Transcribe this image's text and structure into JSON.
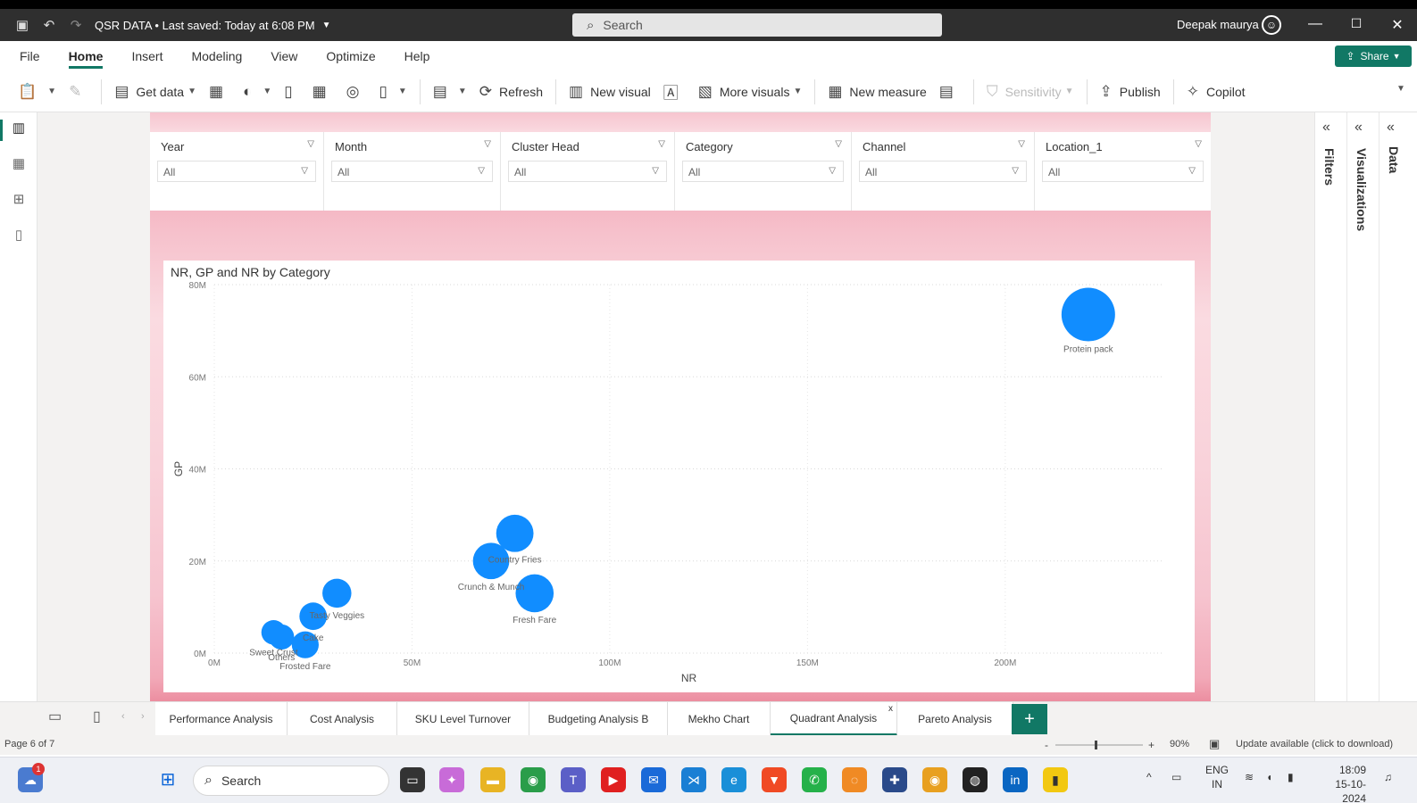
{
  "titlebar": {
    "title": "QSR DATA • Last saved: Today at 6:08 PM",
    "search_placeholder": "Search",
    "user": "Deepak maurya"
  },
  "menu": [
    "File",
    "Home",
    "Insert",
    "Modeling",
    "View",
    "Optimize",
    "Help"
  ],
  "share_label": "Share",
  "ribbon": {
    "get_data": "Get data",
    "refresh": "Refresh",
    "new_visual": "New visual",
    "more_visuals": "More visuals",
    "new_measure": "New measure",
    "sensitivity": "Sensitivity",
    "publish": "Publish",
    "copilot": "Copilot"
  },
  "slicers": [
    {
      "label": "Year",
      "value": "All"
    },
    {
      "label": "Month",
      "value": "All"
    },
    {
      "label": "Cluster Head",
      "value": "All"
    },
    {
      "label": "Category",
      "value": "All"
    },
    {
      "label": "Channel",
      "value": "All"
    },
    {
      "label": "Location_1",
      "value": "All"
    }
  ],
  "right_panes": {
    "filters": "Filters",
    "visualizations": "Visualizations",
    "data": "Data"
  },
  "chart_data": {
    "type": "scatter",
    "title": "NR, GP and NR by Category",
    "xlabel": "NR",
    "ylabel": "GP",
    "x_ticks": [
      "0M",
      "50M",
      "100M",
      "150M",
      "200M"
    ],
    "y_ticks": [
      "0M",
      "20M",
      "40M",
      "60M",
      "80M"
    ],
    "xlim": [
      0,
      240
    ],
    "ylim": [
      0,
      80
    ],
    "x_unit": "M",
    "y_unit": "M",
    "grid": true,
    "color": "#118DFF",
    "points": [
      {
        "label": "Protein pack",
        "x": 221,
        "y": 73.5,
        "size": 221
      },
      {
        "label": "Country Fries",
        "x": 76,
        "y": 26,
        "size": 76
      },
      {
        "label": "Crunch & Munch",
        "x": 70,
        "y": 20,
        "size": 70
      },
      {
        "label": "Fresh Fare",
        "x": 81,
        "y": 13,
        "size": 81
      },
      {
        "label": "Tasty Veggies",
        "x": 31,
        "y": 13,
        "size": 31
      },
      {
        "label": "Cake",
        "x": 25,
        "y": 8,
        "size": 25
      },
      {
        "label": "Sweet Crust",
        "x": 15,
        "y": 4.5,
        "size": 15
      },
      {
        "label": "Others",
        "x": 17,
        "y": 3.5,
        "size": 17
      },
      {
        "label": "Frosted Fare",
        "x": 23,
        "y": 1.8,
        "size": 23
      }
    ]
  },
  "tabs": [
    "Performance Analysis",
    "Cost Analysis",
    "SKU Level Turnover",
    "Budgeting Analysis B",
    "Mekho Chart",
    "Quadrant Analysis",
    "Pareto Analysis"
  ],
  "active_tab": "Quadrant Analysis",
  "status": {
    "page": "Page 6 of 7",
    "zoom": "90%",
    "update": "Update available (click to download)"
  },
  "taskbar": {
    "search": "Search",
    "lang_top": "ENG",
    "lang_bottom": "IN",
    "time": "18:09",
    "date": "15-10-2024"
  }
}
